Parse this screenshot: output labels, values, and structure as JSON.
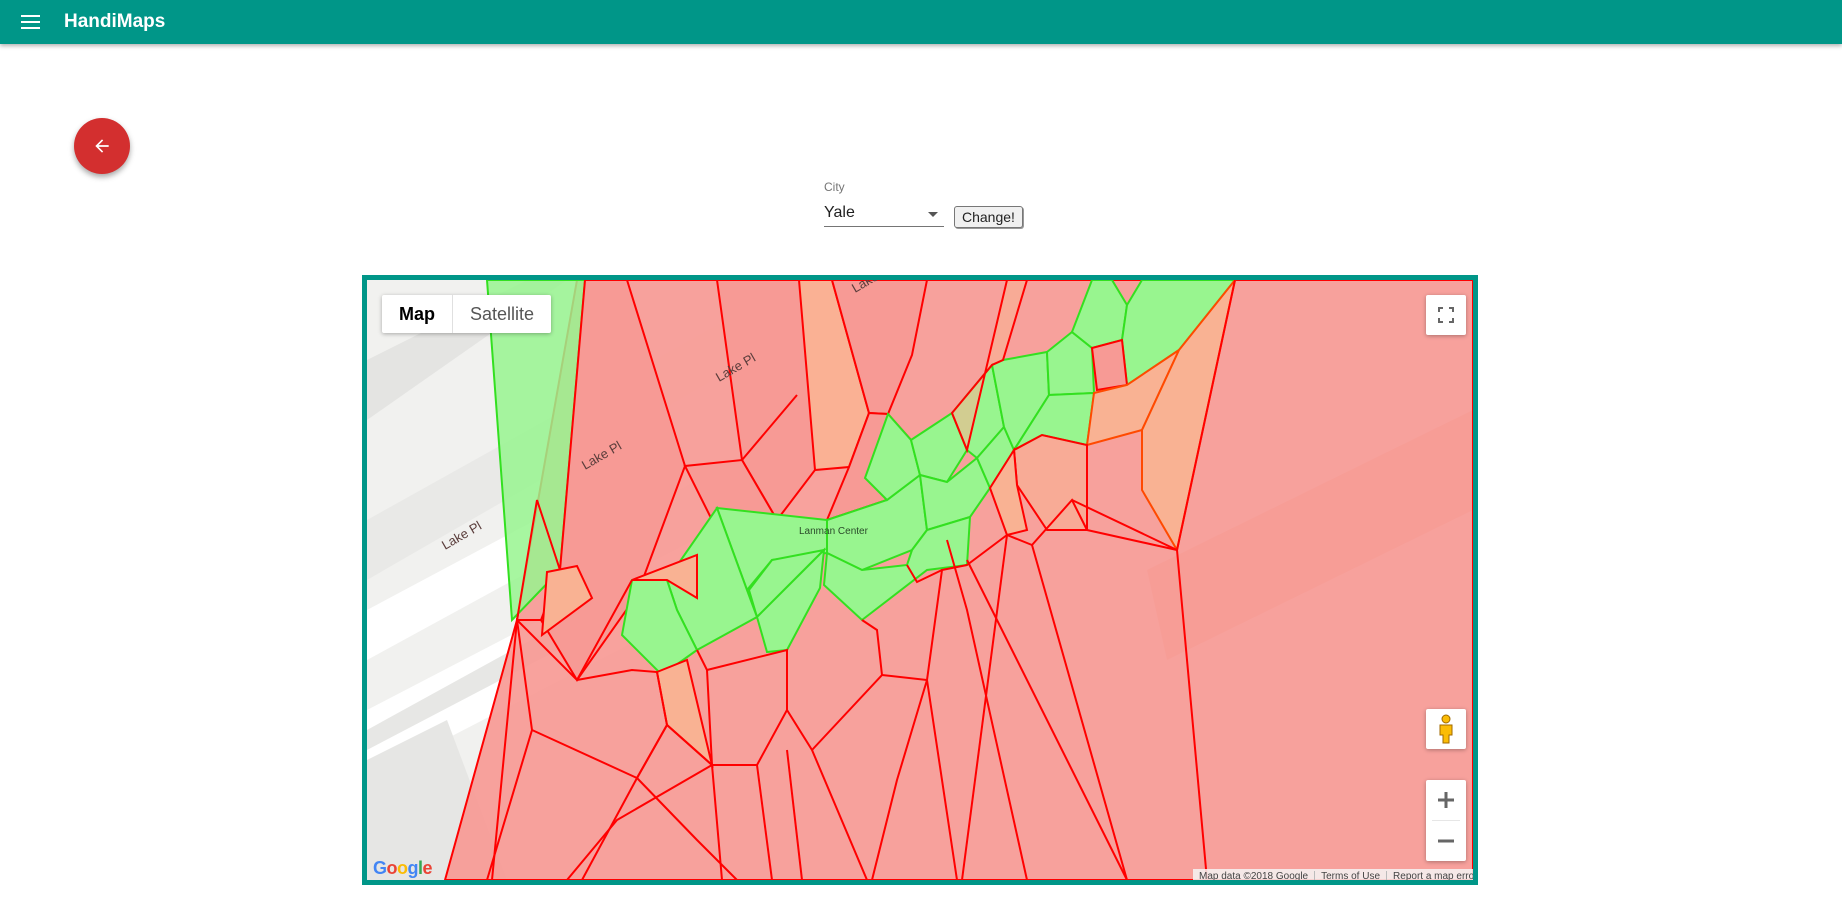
{
  "app": {
    "title": "HandiMaps"
  },
  "form": {
    "city_label": "City",
    "city_value": "Yale",
    "change_button": "Change!"
  },
  "map": {
    "type_buttons": {
      "map": "Map",
      "satellite": "Satellite"
    },
    "street_labels": [
      "Lake Pl",
      "Lake Pl",
      "Lake Pl",
      "Lake Pl"
    ],
    "place_label": "Lanman Center",
    "attribution": {
      "data": "Map data ©2018 Google",
      "terms": "Terms of Use",
      "report": "Report a map error"
    },
    "google_logo": [
      "G",
      "o",
      "o",
      "g",
      "l",
      "e"
    ],
    "logo_colors": [
      "#4285F4",
      "#EA4335",
      "#FBBC05",
      "#4285F4",
      "#34A853",
      "#EA4335"
    ],
    "region_colors": {
      "red": "#f79a95",
      "green": "#98f58f",
      "orange": "#f9b293"
    },
    "border_colors": {
      "red": "#ff0000",
      "green": "#33e020",
      "orange": "#ff4a00"
    },
    "frame_color": "#009688"
  },
  "icons": {
    "menu": "menu-icon",
    "back": "arrow-back-icon",
    "fullscreen": "fullscreen-icon",
    "pegman": "pegman-icon",
    "zoom_in": "plus-icon",
    "zoom_out": "minus-icon"
  }
}
